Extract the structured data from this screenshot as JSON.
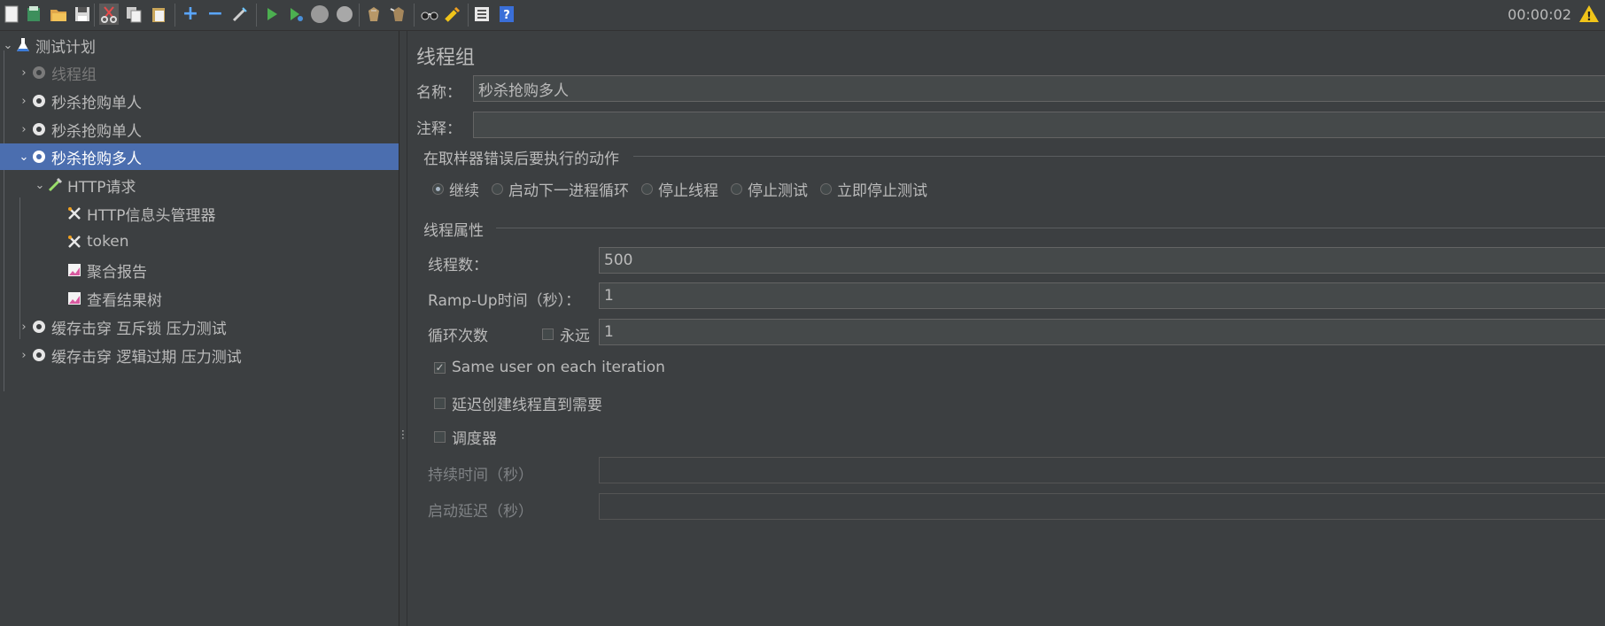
{
  "toolbar": {
    "timer": "00:00:02",
    "icons": [
      "new-icon",
      "templates-icon",
      "open-icon",
      "save-icon",
      "cut-icon",
      "copy-icon",
      "paste-icon",
      "add-icon",
      "remove-icon",
      "toggle-icon",
      "start-icon",
      "start-no-pause-icon",
      "stop-icon",
      "shutdown-icon",
      "clear-icon",
      "clear-all-icon",
      "search-icon",
      "reset-search-icon",
      "function-helper-icon",
      "help-icon",
      "warning-icon"
    ]
  },
  "tree": {
    "items": [
      {
        "label": "测试计划",
        "icon": "test-plan-icon",
        "expanded": true,
        "level": 0
      },
      {
        "label": "线程组",
        "icon": "thread-group-icon",
        "level": 1,
        "disabled": true
      },
      {
        "label": "秒杀抢购单人",
        "icon": "thread-group-icon",
        "level": 1
      },
      {
        "label": "秒杀抢购单人",
        "icon": "thread-group-icon",
        "level": 1
      },
      {
        "label": "秒杀抢购多人",
        "icon": "thread-group-icon",
        "level": 1,
        "selected": true,
        "expanded": true
      },
      {
        "label": "HTTP请求",
        "icon": "http-sampler-icon",
        "level": 2,
        "expanded": true
      },
      {
        "label": "HTTP信息头管理器",
        "icon": "config-tool-icon",
        "level": 3
      },
      {
        "label": "token",
        "icon": "config-tool-icon",
        "level": 3
      },
      {
        "label": "聚合报告",
        "icon": "listener-chart-icon",
        "level": 3
      },
      {
        "label": "查看结果树",
        "icon": "listener-chart-icon",
        "level": 3
      },
      {
        "label": "缓存击穿 互斥锁 压力测试",
        "icon": "thread-group-icon",
        "level": 1
      },
      {
        "label": "缓存击穿 逻辑过期 压力测试",
        "icon": "thread-group-icon",
        "level": 1
      }
    ]
  },
  "panel": {
    "title": "线程组",
    "name_label": "名称：",
    "name_value": "秒杀抢购多人",
    "comment_label": "注释：",
    "comment_value": "",
    "on_error": {
      "heading": "在取样器错误后要执行的动作",
      "options": [
        "继续",
        "启动下一进程循环",
        "停止线程",
        "停止测试",
        "立即停止测试"
      ],
      "selected": "继续"
    },
    "thread_props": {
      "heading": "线程属性",
      "threads_label": "线程数：",
      "threads_value": "500",
      "rampup_label": "Ramp-Up时间（秒）：",
      "rampup_value": "1",
      "loop_label": "循环次数",
      "forever_label": "永远",
      "forever_checked": false,
      "loop_value": "1",
      "same_user_label": "Same user on each iteration",
      "same_user_checked": true,
      "delay_label": "延迟创建线程直到需要",
      "delay_checked": false,
      "scheduler_label": "调度器",
      "scheduler_checked": false,
      "duration_label": "持续时间（秒）",
      "duration_value": "",
      "startup_delay_label": "启动延迟（秒）",
      "startup_delay_value": ""
    }
  },
  "colors": {
    "background": "#3c3f41",
    "selection": "#4b6eaf",
    "field": "#45494a",
    "text": "#bbbbbb",
    "play_green": "#4caf50",
    "warning": "#f0c419"
  }
}
